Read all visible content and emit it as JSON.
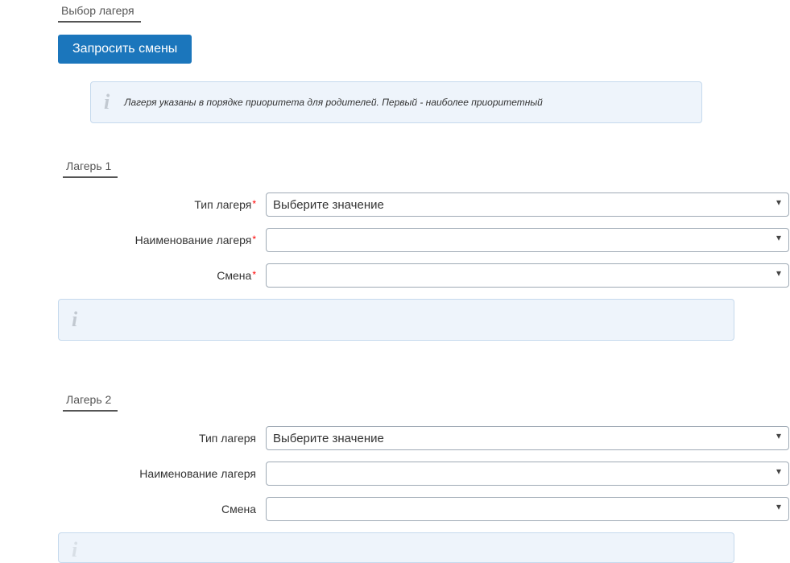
{
  "header": {
    "main_section": "Выбор лагеря",
    "request_button": "Запросить смены",
    "info_text": "Лагеря указаны в порядке приоритета для родителей. Первый - наиболее приоритетный"
  },
  "camps": [
    {
      "title": "Лагерь 1",
      "required": true,
      "fields": {
        "type_label": "Тип лагеря",
        "type_placeholder": "Выберите значение",
        "name_label": "Наименование лагеря",
        "name_placeholder": "",
        "session_label": "Смена",
        "session_placeholder": ""
      }
    },
    {
      "title": "Лагерь 2",
      "required": false,
      "fields": {
        "type_label": "Тип лагеря",
        "type_placeholder": "Выберите значение",
        "name_label": "Наименование лагеря",
        "name_placeholder": "",
        "session_label": "Смена",
        "session_placeholder": ""
      }
    }
  ]
}
